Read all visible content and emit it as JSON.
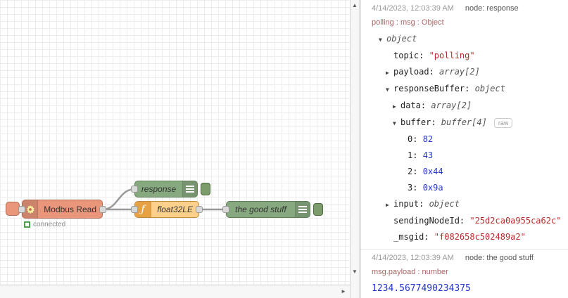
{
  "colors": {
    "modbus_node": "#e9967a",
    "modbus_border": "#b06a52",
    "debug_node": "#87a980",
    "debug_border": "#5f7d56",
    "function_node": "#fdd08c",
    "function_border": "#c08c3f",
    "function_icon_bg": "#e5a143",
    "wire": "#999999",
    "status_green": "#4ca14c",
    "meta_text": "#999999",
    "msg_path": "#aa6666",
    "string_value": "#b72c2c",
    "number_value": "#2336cc"
  },
  "icons": {
    "disclosure_expanded": "▼",
    "disclosure_collapsed": "▶",
    "scroll_up": "▲",
    "scroll_down": "▼",
    "scroll_right": "►",
    "function_icon": "ƒ"
  },
  "flow": {
    "nodes": {
      "modbus_read": {
        "label": "Modbus Read",
        "status": "connected"
      },
      "response": {
        "label": "response"
      },
      "float32le": {
        "label": "float32LE"
      },
      "the_good_stuff": {
        "label": "the good stuff"
      }
    }
  },
  "debug": {
    "raw_label": "raw",
    "messages": [
      {
        "timestamp": "4/14/2023, 12:03:39 AM",
        "node": "node: response",
        "path": "polling : msg : Object",
        "rows": [
          {
            "indent": 0,
            "arrow": "expanded",
            "value": "object",
            "vtype": "type"
          },
          {
            "indent": 1,
            "key": "topic",
            "value": "\"polling\"",
            "vtype": "string"
          },
          {
            "indent": 1,
            "arrow": "collapsed",
            "key": "payload",
            "value": "array[2]",
            "vtype": "type"
          },
          {
            "indent": 1,
            "arrow": "expanded",
            "key": "responseBuffer",
            "value": "object",
            "vtype": "type"
          },
          {
            "indent": 2,
            "arrow": "collapsed",
            "key": "data",
            "value": "array[2]",
            "vtype": "type"
          },
          {
            "indent": 2,
            "arrow": "expanded",
            "key": "buffer",
            "value": "buffer[4]",
            "vtype": "type",
            "raw": true
          },
          {
            "indent": 3,
            "key": "0",
            "value": "82",
            "vtype": "number"
          },
          {
            "indent": 3,
            "key": "1",
            "value": "43",
            "vtype": "number"
          },
          {
            "indent": 3,
            "key": "2",
            "value": "0x44",
            "vtype": "number"
          },
          {
            "indent": 3,
            "key": "3",
            "value": "0x9a",
            "vtype": "number"
          },
          {
            "indent": 1,
            "arrow": "collapsed",
            "key": "input",
            "value": "object",
            "vtype": "type"
          },
          {
            "indent": 1,
            "key": "sendingNodeId",
            "value": "\"25d2ca0a955ca62c\"",
            "vtype": "string"
          },
          {
            "indent": 1,
            "key": "_msgid",
            "value": "\"f082658c502489a2\"",
            "vtype": "string"
          }
        ]
      },
      {
        "timestamp": "4/14/2023, 12:03:39 AM",
        "node": "node: the good stuff",
        "path": "msg.payload : number",
        "value": "1234.5677490234375"
      }
    ]
  }
}
